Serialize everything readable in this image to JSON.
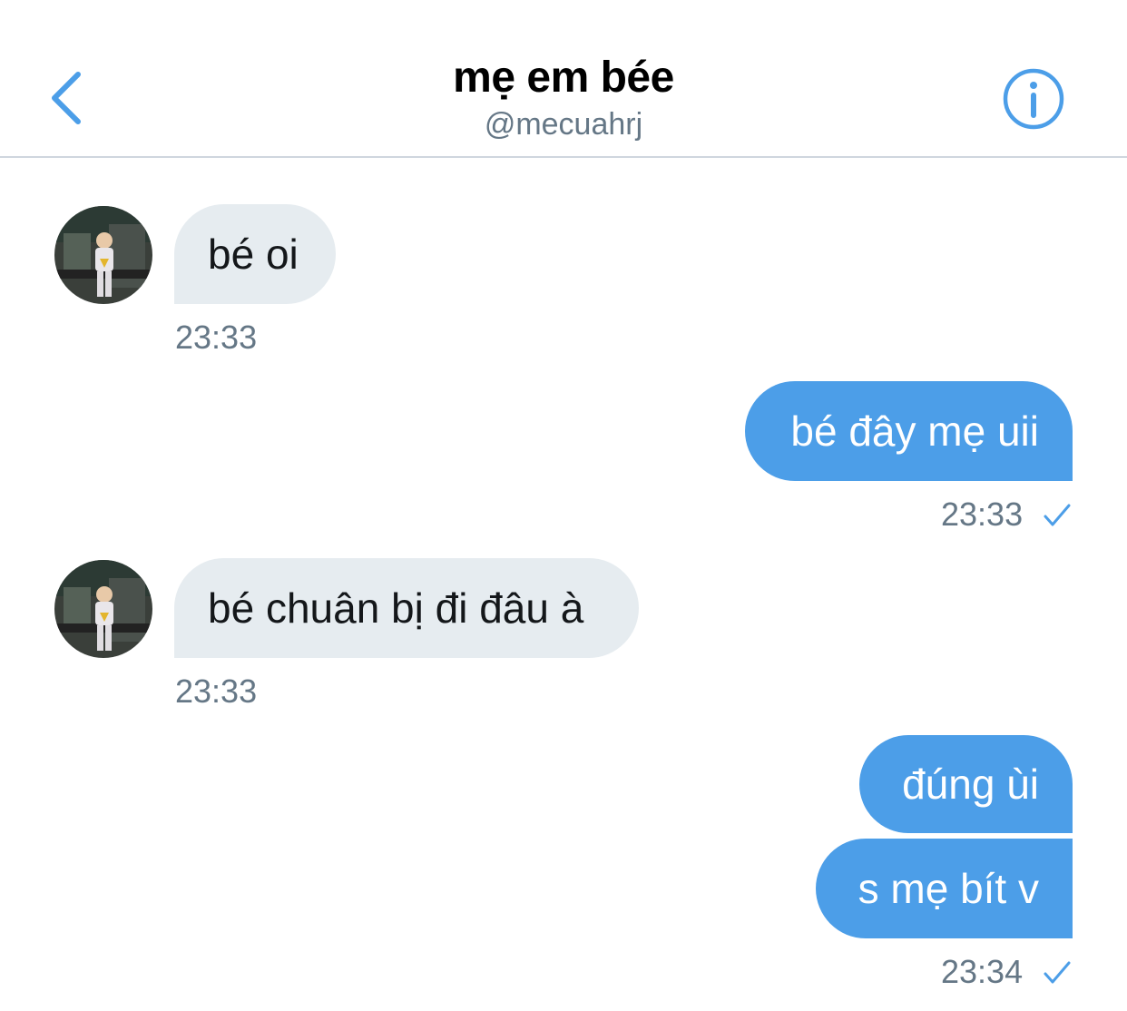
{
  "header": {
    "title": "mẹ em bée",
    "handle": "@mecuahrj",
    "back_icon": "chevron-left-icon",
    "info_icon": "info-circle-icon"
  },
  "messages": [
    {
      "side": "incoming",
      "text": "bé oi",
      "time": "23:33"
    },
    {
      "side": "outgoing",
      "text": "bé đây mẹ uii",
      "time": "23:33",
      "status": "sent"
    },
    {
      "side": "incoming",
      "text": "bé chuân bị đi đâu à",
      "time": "23:33"
    },
    {
      "side": "outgoing",
      "text": "đúng ùi"
    },
    {
      "side": "outgoing",
      "text": "s mẹ bít v",
      "time": "23:34",
      "status": "sent"
    }
  ],
  "colors": {
    "accent": "#4c9ee8",
    "incoming_bubble": "#e6ecf0",
    "secondary_text": "#657786",
    "divider": "#cfd6de"
  }
}
